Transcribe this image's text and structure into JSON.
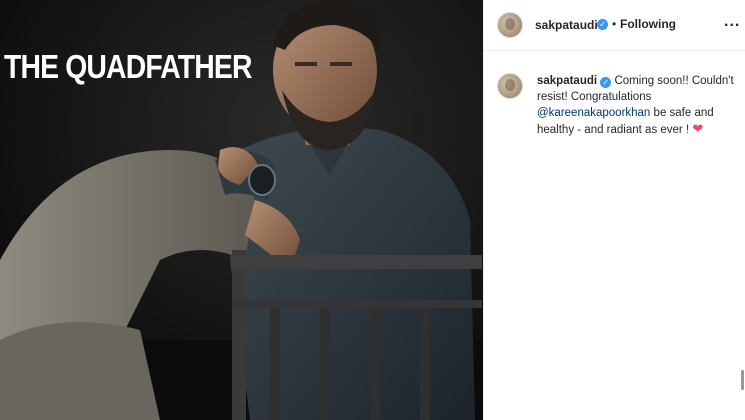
{
  "post": {
    "image_caption": "THE QUADFATHER"
  },
  "header": {
    "username": "sakpataudi",
    "separator": "•",
    "follow_status": "Following",
    "more_label": "..."
  },
  "comment": {
    "username": "sakpataudi",
    "text_1": "Coming soon!! Couldn't resist! Congratulations",
    "mention": "@kareenakapoorkhan",
    "text_2": "be safe and healthy - and radiant as ever !",
    "emoji": "❤"
  },
  "icons": {
    "verified": "verified-badge-icon",
    "heart": "heart-emoji-icon"
  },
  "colors": {
    "verified": "#3897f0",
    "mention": "#00376b",
    "heart": "#ed4956"
  }
}
